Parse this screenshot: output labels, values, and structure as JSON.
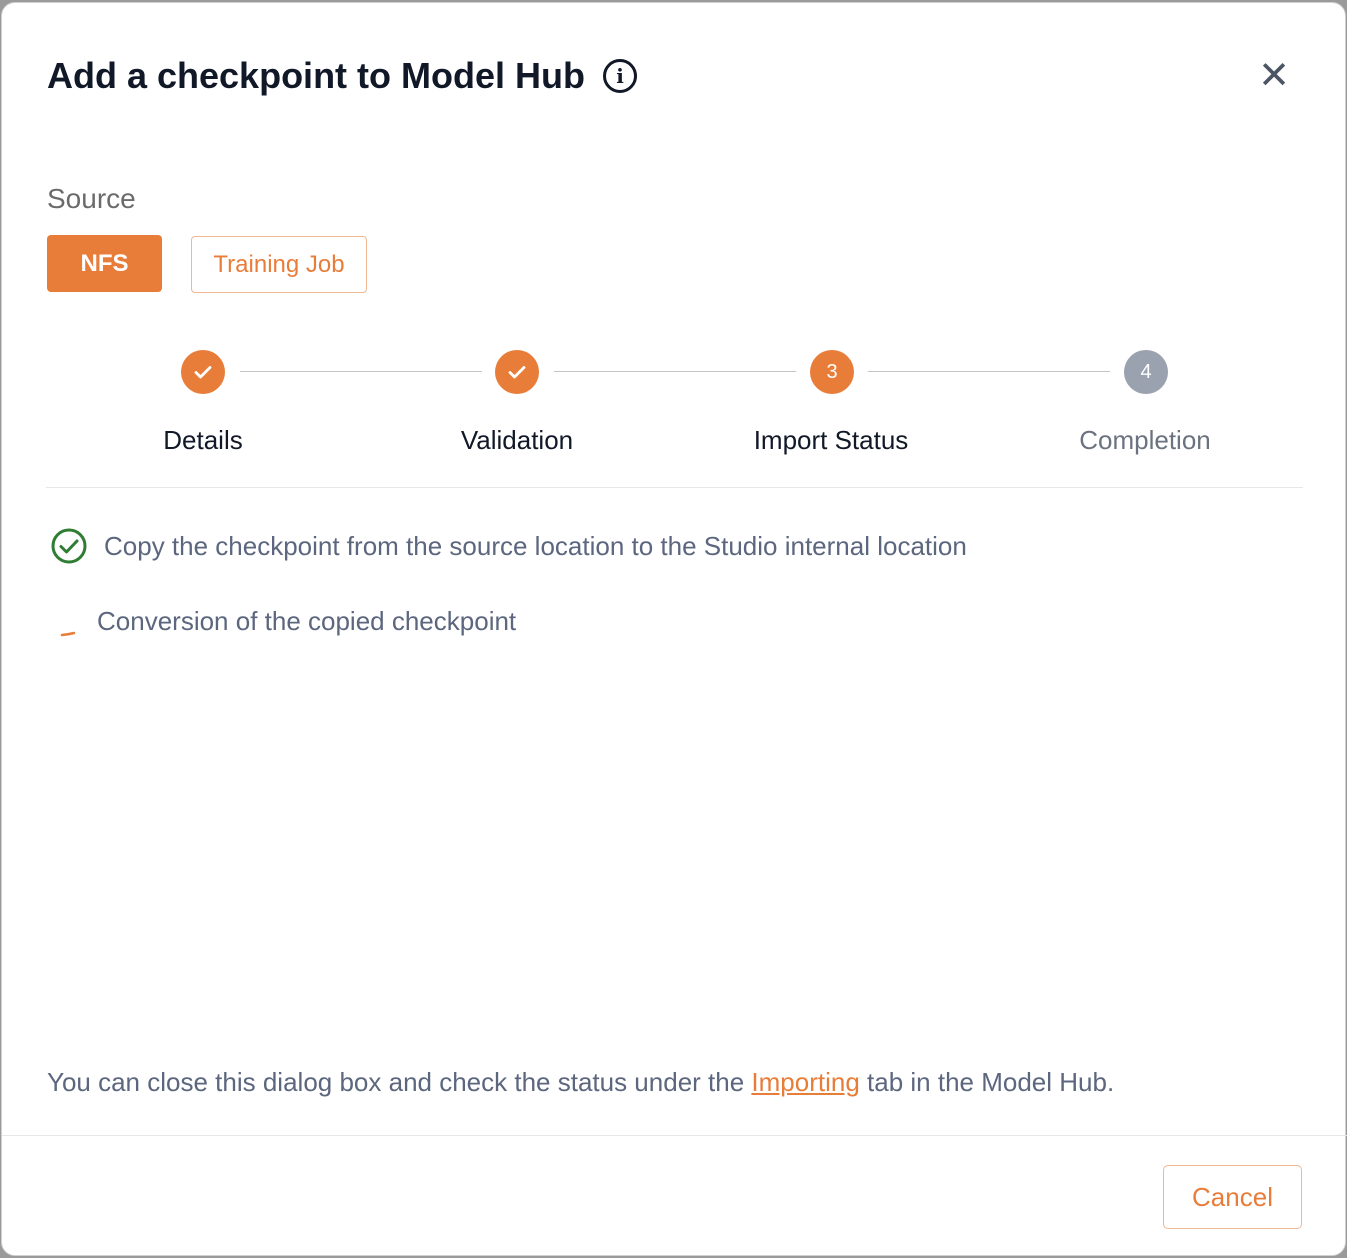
{
  "dialog": {
    "title": "Add a checkpoint to Model Hub",
    "close_icon": "close-icon",
    "info_icon": "info-icon",
    "source": {
      "label": "Source",
      "options": [
        {
          "label": "NFS",
          "selected": true
        },
        {
          "label": "Training Job",
          "selected": false
        }
      ]
    },
    "steps": [
      {
        "number": "1",
        "label": "Details",
        "state": "done"
      },
      {
        "number": "2",
        "label": "Validation",
        "state": "done"
      },
      {
        "number": "3",
        "label": "Import Status",
        "state": "current"
      },
      {
        "number": "4",
        "label": "Completion",
        "state": "todo"
      }
    ],
    "tasks": [
      {
        "label": "Copy the checkpoint from the source location to the Studio internal location",
        "status": "complete"
      },
      {
        "label": "Conversion of the copied checkpoint",
        "status": "in-progress"
      }
    ],
    "note": {
      "before": "You can close this dialog box and check the status under the ",
      "link": "Importing",
      "after": " tab in the Model Hub."
    },
    "cancel_label": "Cancel",
    "colors": {
      "accent": "#e87d3a",
      "success": "#2e7d32",
      "pending": "#9aa1af"
    }
  }
}
